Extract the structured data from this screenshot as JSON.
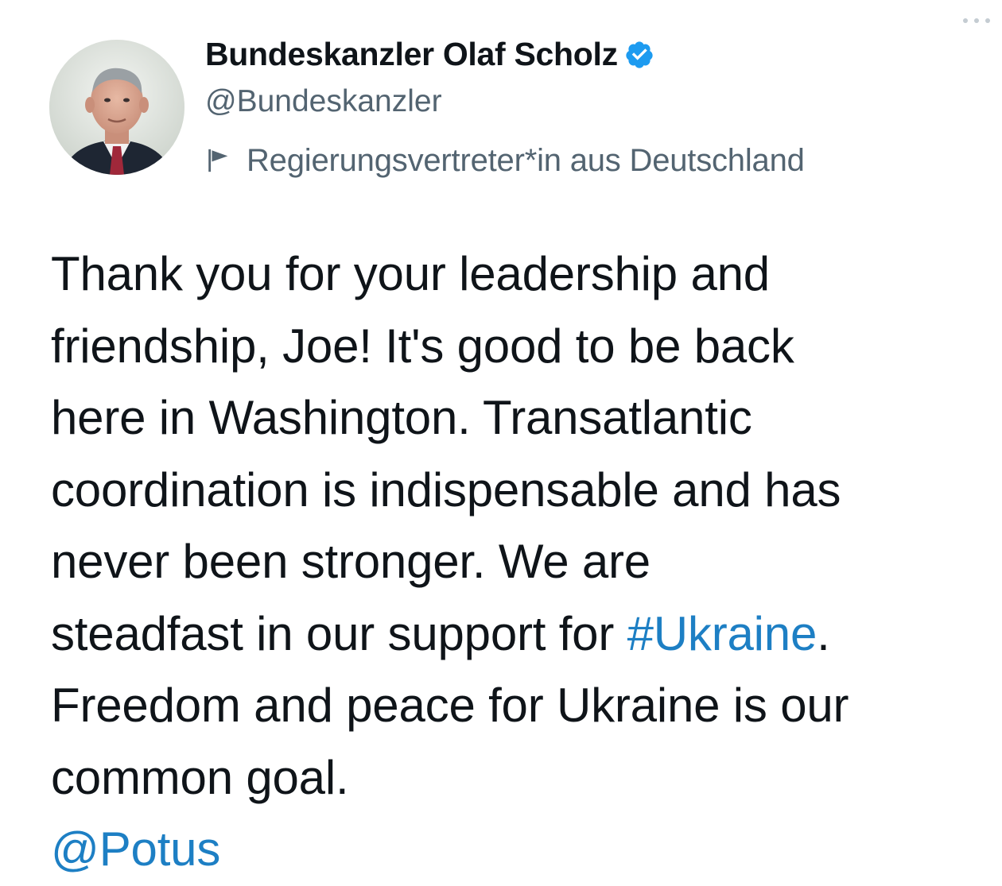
{
  "author": {
    "display_name": "Bundeskanzler Olaf Scholz",
    "handle": "@Bundeskanzler",
    "verified_icon": "verified-badge-icon",
    "government_label": "Regierungsvertreter*in aus Deutschland",
    "label_icon": "flag-icon"
  },
  "menu": {
    "icon": "more-options-icon"
  },
  "tweet": {
    "lines": [
      "Thank you for your leadership and",
      "friendship, Joe! It's good to be back",
      "here in Washington. Transatlantic",
      "coordination is indispensable and has",
      "never been stronger. We are"
    ],
    "line6_prefix": "steadfast in our support for ",
    "hashtag": "#Ukraine",
    "line6_suffix": ".",
    "lines_after": [
      "Freedom and peace for Ukraine is our",
      "common goal."
    ],
    "mention": "@Potus"
  },
  "colors": {
    "text": "#0f1419",
    "secondary": "#536471",
    "link": "#1d7fc4",
    "verified": "#1d9bf0"
  }
}
